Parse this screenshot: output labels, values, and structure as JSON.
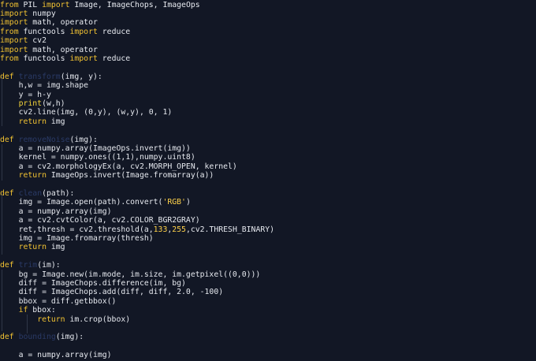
{
  "editor": {
    "lines": [
      [
        [
          "k",
          "from"
        ],
        [
          "pl",
          " PIL "
        ],
        [
          "k",
          "import"
        ],
        [
          "pl",
          " Image, ImageChops, ImageOps"
        ]
      ],
      [
        [
          "k",
          "import"
        ],
        [
          "pl",
          " numpy"
        ]
      ],
      [
        [
          "k",
          "import"
        ],
        [
          "pl",
          " math, operator"
        ]
      ],
      [
        [
          "k",
          "from"
        ],
        [
          "pl",
          " functools "
        ],
        [
          "k",
          "import"
        ],
        [
          "pl",
          " reduce"
        ]
      ],
      [
        [
          "k",
          "import"
        ],
        [
          "pl",
          " cv2"
        ]
      ],
      [
        [
          "k",
          "import"
        ],
        [
          "pl",
          " math, operator"
        ]
      ],
      [
        [
          "k",
          "from"
        ],
        [
          "pl",
          " functools "
        ],
        [
          "k",
          "import"
        ],
        [
          "pl",
          " reduce"
        ]
      ],
      [],
      [
        [
          "k",
          "def"
        ],
        [
          "pl",
          " "
        ],
        [
          "fn",
          "transform"
        ],
        [
          "pl",
          "(img, y):"
        ]
      ],
      [
        [
          "pl",
          "    h,w = img.shape"
        ]
      ],
      [
        [
          "pl",
          "    y = h-y"
        ]
      ],
      [
        [
          "pl",
          "    "
        ],
        [
          "bi",
          "print"
        ],
        [
          "pl",
          "(w,h)"
        ]
      ],
      [
        [
          "pl",
          "    cv2.line(img, (0,y), (w,y), 0, 1)"
        ]
      ],
      [
        [
          "pl",
          "    "
        ],
        [
          "k",
          "return"
        ],
        [
          "pl",
          " img"
        ]
      ],
      [],
      [
        [
          "k",
          "def"
        ],
        [
          "pl",
          " "
        ],
        [
          "fn",
          "removeNoise"
        ],
        [
          "pl",
          "(img):"
        ]
      ],
      [
        [
          "pl",
          "    a = numpy.array(ImageOps.invert(img))"
        ]
      ],
      [
        [
          "pl",
          "    kernel = numpy.ones((1,1),numpy.uint8)"
        ]
      ],
      [
        [
          "pl",
          "    a = cv2.morphologyEx(a, cv2.MORPH_OPEN, kernel)"
        ]
      ],
      [
        [
          "pl",
          "    "
        ],
        [
          "k",
          "return"
        ],
        [
          "pl",
          " ImageOps.invert(Image.fromarray(a))"
        ]
      ],
      [],
      [
        [
          "k",
          "def"
        ],
        [
          "pl",
          " "
        ],
        [
          "fn",
          "clean"
        ],
        [
          "pl",
          "(path):"
        ]
      ],
      [
        [
          "pl",
          "    img = Image.open(path).convert("
        ],
        [
          "st",
          "'RGB'"
        ],
        [
          "pl",
          ")"
        ]
      ],
      [
        [
          "pl",
          "    a = numpy.array(img)"
        ]
      ],
      [
        [
          "pl",
          "    a = cv2.cvtColor(a, cv2.COLOR_BGR2GRAY)"
        ]
      ],
      [
        [
          "pl",
          "    ret,thresh = cv2.threshold(a,"
        ],
        [
          "nm",
          "133"
        ],
        [
          "pl",
          ","
        ],
        [
          "nm",
          "255"
        ],
        [
          "pl",
          ",cv2.THRESH_BINARY)"
        ]
      ],
      [
        [
          "pl",
          "    img = Image.fromarray(thresh)"
        ]
      ],
      [
        [
          "pl",
          "    "
        ],
        [
          "k",
          "return"
        ],
        [
          "pl",
          " img"
        ]
      ],
      [],
      [
        [
          "k",
          "def"
        ],
        [
          "pl",
          " "
        ],
        [
          "fn",
          "trim"
        ],
        [
          "pl",
          "(im):"
        ]
      ],
      [
        [
          "pl",
          "    bg = Image.new(im.mode, im.size, im.getpixel((0,0)))"
        ]
      ],
      [
        [
          "pl",
          "    diff = ImageChops.difference(im, bg)"
        ]
      ],
      [
        [
          "pl",
          "    diff = ImageChops.add(diff, diff, 2.0, -100)"
        ]
      ],
      [
        [
          "pl",
          "    bbox = diff.getbbox()"
        ]
      ],
      [
        [
          "pl",
          "    "
        ],
        [
          "k",
          "if"
        ],
        [
          "pl",
          " bbox:"
        ]
      ],
      [
        [
          "pl",
          "        "
        ],
        [
          "k",
          "return"
        ],
        [
          "pl",
          " im.crop(bbox)"
        ]
      ],
      [],
      [
        [
          "k",
          "def"
        ],
        [
          "pl",
          " "
        ],
        [
          "fn",
          "bounding"
        ],
        [
          "pl",
          "(img):"
        ]
      ],
      [],
      [
        [
          "pl",
          "    a = numpy.array(img)"
        ]
      ]
    ]
  }
}
